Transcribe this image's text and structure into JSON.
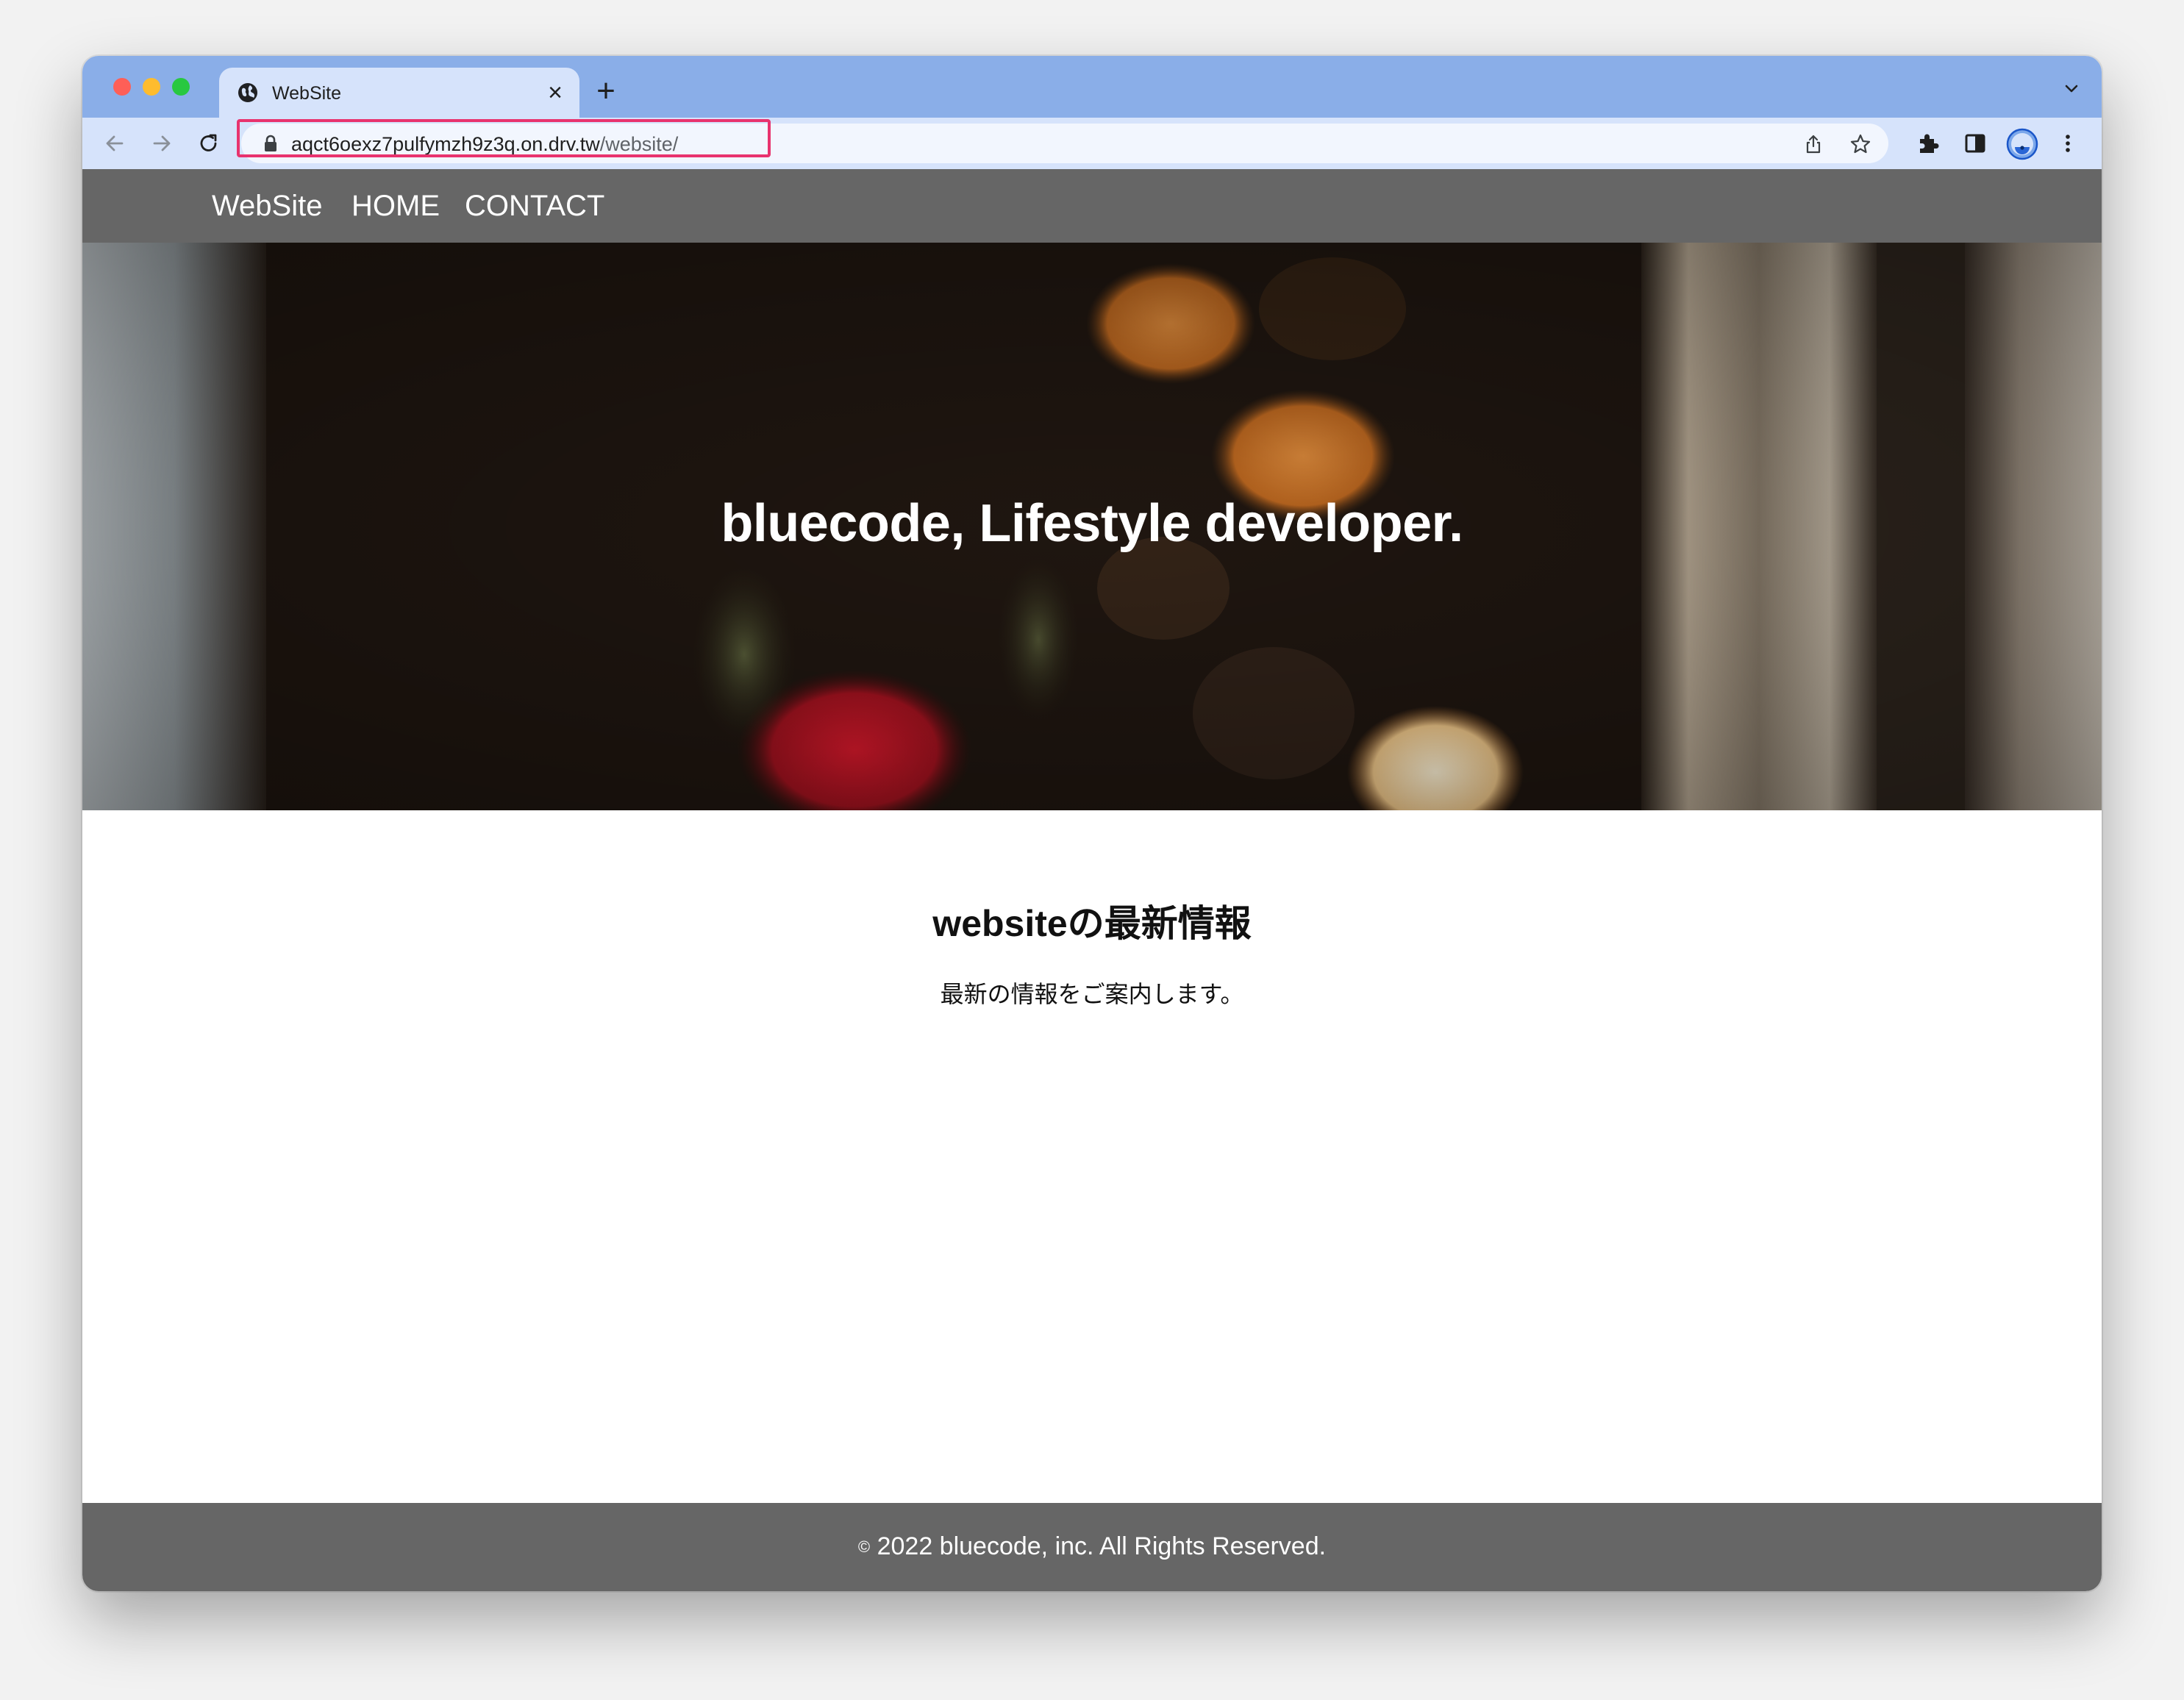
{
  "browser": {
    "tab": {
      "title": "WebSite",
      "favicon": "globe-icon",
      "close": "×"
    },
    "new_tab": "+",
    "url": {
      "host": "aqct6oexz7pulfymzh9z3q.on.drv.tw",
      "path": "/website/"
    },
    "highlight_color": "#e8336e",
    "tabstrip_color": "#8aaee8",
    "toolbar_color": "#d6e3fb",
    "icons": [
      "back-icon",
      "forward-icon",
      "reload-icon",
      "lock-icon",
      "share-icon",
      "star-icon",
      "extensions-icon",
      "side-panel-icon",
      "profile-icon",
      "menu-icon",
      "chevron-down-icon"
    ]
  },
  "site": {
    "nav": {
      "brand": "WebSite",
      "home": "HOME",
      "contact": "CONTACT"
    },
    "hero": {
      "title": "bluecode, Lifestyle developer."
    },
    "news": {
      "heading": "websiteの最新情報",
      "text": "最新の情報をご案内します。"
    },
    "footer": {
      "copyright_symbol": "©",
      "text": " 2022 bluecode, inc. All Rights Reserved."
    },
    "colors": {
      "nav_bg": "#666666",
      "footer_bg": "#666666",
      "text_light": "#ffffff"
    }
  }
}
